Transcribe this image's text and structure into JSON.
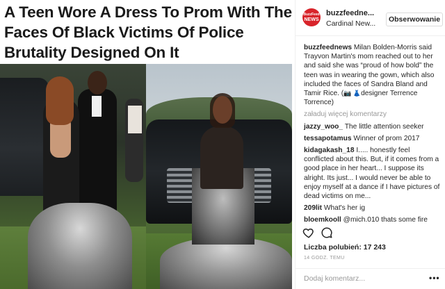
{
  "article": {
    "headline": "A Teen Wore A Dress To Prom With The Faces Of Black Victims Of Police Brutality Designed On It"
  },
  "post": {
    "avatar_text_line1": "BuzzFeed",
    "avatar_text_line2": "NEWS",
    "username": "buzzfeedne...",
    "location": "Cardinal New...",
    "follow_label": "Obserwowanie",
    "caption_user": "buzzfeednews",
    "caption_text": " Milan Bolden-Morris said Trayvon Martin's mom reached out to her and said she was “proud of how bold” the teen was in wearing the gown, which also included the faces of Sandra Bland and Tamir Rice. (",
    "caption_emoji": "📷 👗",
    "caption_tail": "designer Terrence Torrence)",
    "load_more": "załaduj więcej komentarzy",
    "comments": [
      {
        "user": "jazzy_woo_",
        "text": " The little attention seeker"
      },
      {
        "user": "tessapotamus",
        "text": " Winner of prom 2017"
      },
      {
        "user": "kidagakash_18",
        "text": " I..... honestly feel conflicted about this. But, if it comes from a good place in her heart... I suppose its alright. Its just... I would never be able to enjoy myself at a dance if I have pictures of dead victims on me..."
      },
      {
        "user": "209lit",
        "text": " What's her ig"
      },
      {
        "user": "bloemkooll",
        "text": " @mich.010 thats some fire"
      }
    ],
    "likes": "Liczba polubień: 17 243",
    "time_ago": "14 GODZ. TEMU",
    "add_comment_placeholder": "Dodaj komentarz...",
    "more_label": "•••"
  },
  "icons": {
    "heart": "heart-icon",
    "comment": "comment-icon",
    "more": "more-options-icon"
  }
}
